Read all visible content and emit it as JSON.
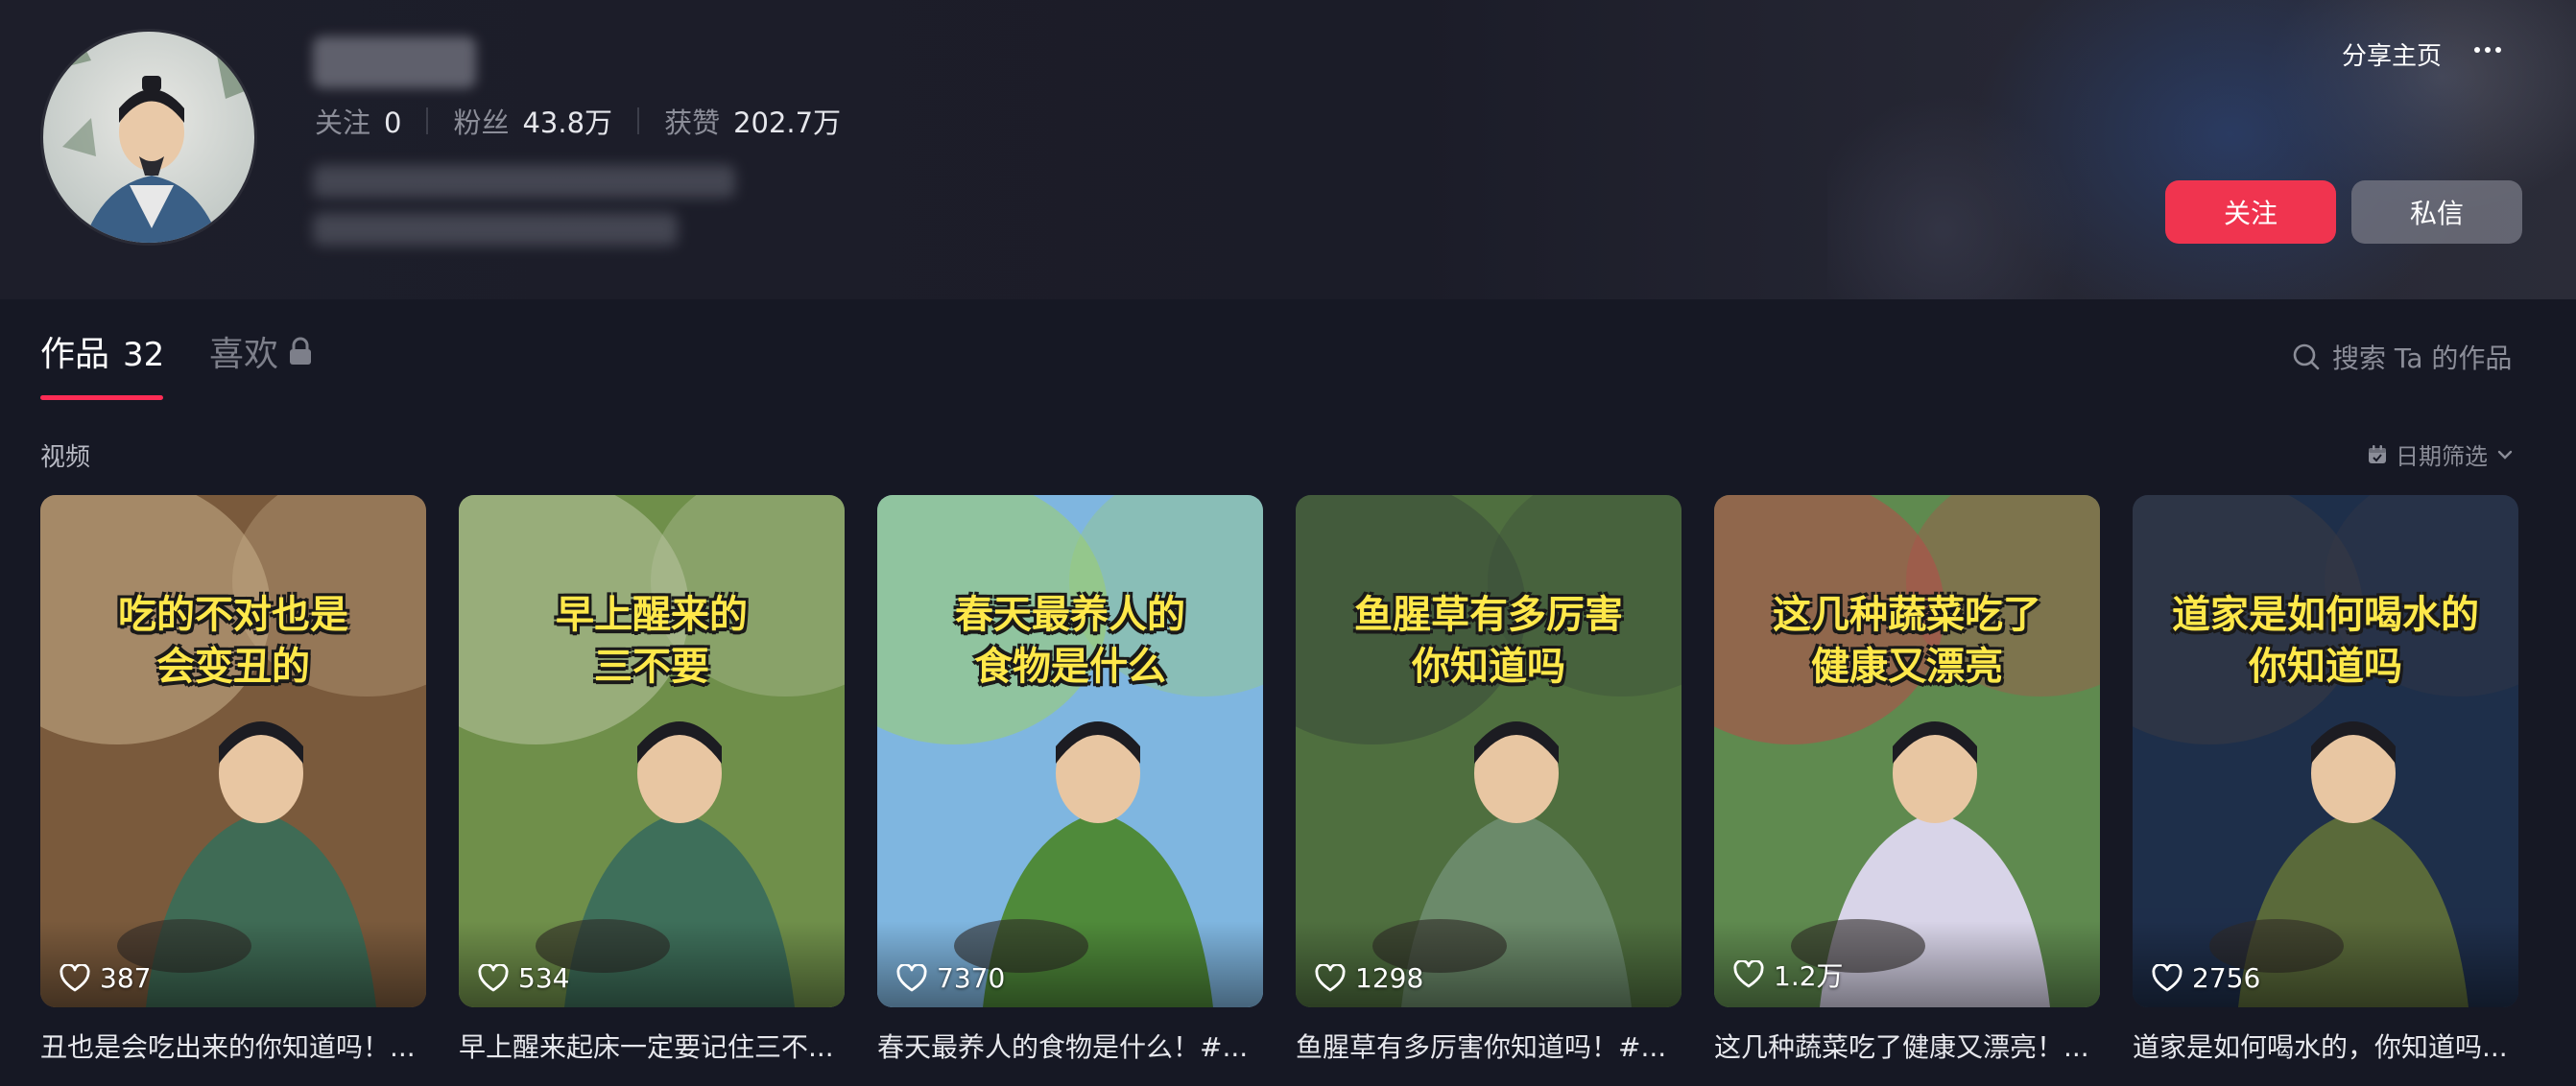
{
  "profile": {
    "stats": [
      {
        "label": "关注",
        "value": "0"
      },
      {
        "label": "粉丝",
        "value": "43.8万"
      },
      {
        "label": "获赞",
        "value": "202.7万"
      }
    ],
    "share_label": "分享主页",
    "follow_label": "关注",
    "message_label": "私信"
  },
  "tabs": {
    "works_label": "作品",
    "works_count": "32",
    "likes_label": "喜欢"
  },
  "search": {
    "placeholder": "搜索 Ta 的作品"
  },
  "section": {
    "label": "视频",
    "date_filter_label": "日期筛选"
  },
  "videos": [
    {
      "overlay": "吃的不对也是\n会变丑的",
      "likes": "387",
      "title": "丑也是会吃出来的你知道吗！...",
      "palette": [
        "#7a5a3c",
        "#3f6b55",
        "#c9b08a"
      ]
    },
    {
      "overlay": "早上醒来的\n三不要",
      "likes": "534",
      "title": "早上醒来起床一定要记住三不...",
      "palette": [
        "#6f8f4a",
        "#3e6f5a",
        "#b9c6a2"
      ]
    },
    {
      "overlay": "春天最养人的\n食物是什么",
      "likes": "7370",
      "title": "春天最养人的食物是什么！#...",
      "palette": [
        "#7fb6e0",
        "#4f8a3a",
        "#9fcf6a"
      ]
    },
    {
      "overlay": "鱼腥草有多厉害\n你知道吗",
      "likes": "1298",
      "title": "鱼腥草有多厉害你知道吗！#...",
      "palette": [
        "#4f6f3f",
        "#6b8a6a",
        "#3a4a3a"
      ]
    },
    {
      "overlay": "这几种蔬菜吃了\n健康又漂亮",
      "likes": "1.2万",
      "title": "这几种蔬菜吃了健康又漂亮！...",
      "palette": [
        "#5f8a4f",
        "#d8d4e8",
        "#b84a4a"
      ]
    },
    {
      "overlay": "道家是如何喝水的\n你知道吗",
      "likes": "2756",
      "title": "道家是如何喝水的，你知道吗...",
      "palette": [
        "#1e2f4a",
        "#5a6a3a",
        "#3a3a44"
      ]
    }
  ]
}
